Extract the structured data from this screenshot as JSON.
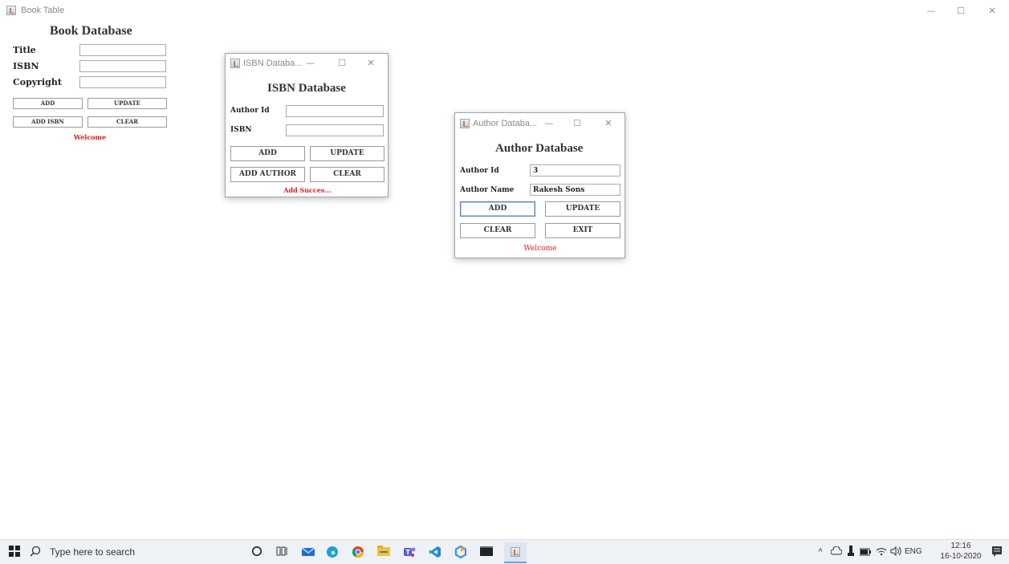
{
  "main_window": {
    "title": "Book Table",
    "controls": {
      "minimize": "—",
      "maximize": "☐",
      "close": "✕"
    },
    "heading": "Book Database",
    "labels": {
      "title": "Title",
      "isbn": "ISBN",
      "copyright": "Copyright"
    },
    "fields": {
      "title": "",
      "isbn": "",
      "copyright": ""
    },
    "buttons": {
      "add": "ADD",
      "update": "UPDATE",
      "add_isbn": "ADD ISBN",
      "clear": "CLEAR"
    },
    "status": "Welcome"
  },
  "isbn_window": {
    "title": "ISBN Databa...",
    "controls": {
      "minimize": "—",
      "maximize": "☐",
      "close": "✕"
    },
    "heading": "ISBN Database",
    "labels": {
      "author_id": "Author Id",
      "isbn": "ISBN"
    },
    "fields": {
      "author_id": "",
      "isbn": ""
    },
    "buttons": {
      "add": "ADD",
      "update": "UPDATE",
      "add_author": "ADD AUTHOR",
      "clear": "CLEAR"
    },
    "status": "Add Succes..."
  },
  "author_window": {
    "title": "Author Databa...",
    "controls": {
      "minimize": "—",
      "maximize": "☐",
      "close": "✕"
    },
    "heading": "Author Database",
    "labels": {
      "author_id": "Author Id",
      "author_name": "Author Name"
    },
    "fields": {
      "author_id": "3",
      "author_name": "Rakesh Sons"
    },
    "buttons": {
      "add": "ADD",
      "update": "UPDATE",
      "clear": "CLEAR",
      "exit": "EXIT"
    },
    "status": "Welcome"
  },
  "taskbar": {
    "search_placeholder": "Type here to search",
    "tray": {
      "language": "ENG",
      "time": "12:16",
      "date": "16-10-2020"
    }
  },
  "colors": {
    "status_red": "#e01818",
    "taskbar_bg": "#eef1f5"
  }
}
